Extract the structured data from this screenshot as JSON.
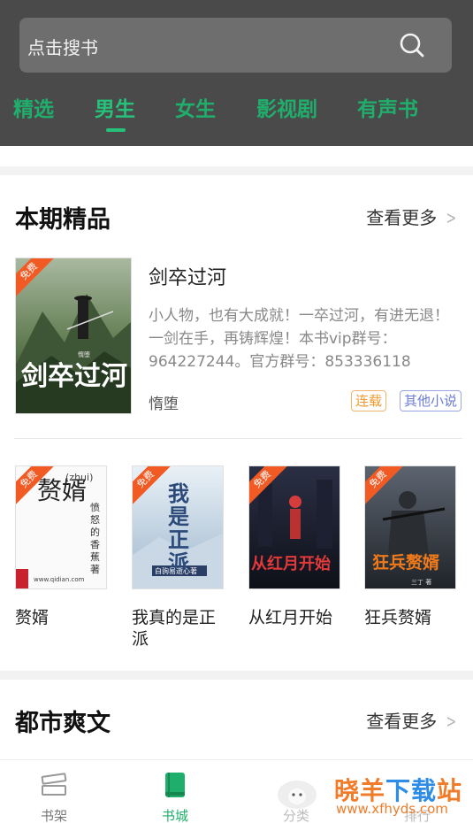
{
  "search": {
    "placeholder": "点击搜书"
  },
  "tabs": [
    {
      "label": "精选",
      "active": false
    },
    {
      "label": "男生",
      "active": true
    },
    {
      "label": "女生",
      "active": false
    },
    {
      "label": "影视剧",
      "active": false
    },
    {
      "label": "有声书",
      "active": false
    }
  ],
  "section1": {
    "title": "本期精品",
    "more": "查看更多",
    "featured": {
      "badge": "免费",
      "cover_title": "剑卒过河",
      "cover_author": "惰堕",
      "title": "剑卒过河",
      "description": "小人物，也有大成就！一卒过河，有进无退！一剑在手，再铸辉煌！本书vip群号：964227244。官方群号：853336118",
      "author": "惰堕",
      "tags": [
        "连载",
        "其他小说"
      ]
    },
    "books": [
      {
        "title": "赘婿",
        "badge": "免费",
        "cover_text": "赘婿",
        "cover_sub": "(zhui)",
        "cover_side": "愤怒的香蕉 著",
        "cover_url": "www.qidian.com"
      },
      {
        "title": "我真的是正派",
        "badge": "免费",
        "cover_text": "我是正派",
        "cover_author": "白驹易逝心著"
      },
      {
        "title": "从红月开始",
        "badge": "免费",
        "cover_text": "从红月开始"
      },
      {
        "title": "狂兵赘婿",
        "badge": "免费",
        "cover_text": "狂兵赘婿",
        "cover_author": "三丁 著"
      }
    ]
  },
  "section2": {
    "title": "都市爽文",
    "more": "查看更多"
  },
  "bottom_nav": [
    {
      "label": "书架",
      "icon": "bookshelf-icon",
      "active": false
    },
    {
      "label": "书城",
      "icon": "book-store-icon",
      "active": true
    },
    {
      "label": "分类",
      "icon": "category-icon",
      "active": false
    },
    {
      "label": "排行",
      "icon": "ranking-icon",
      "active": false
    }
  ],
  "watermark": {
    "orange": "晓羊",
    "blue": "下载",
    "orange2": "站",
    "url": "www.xfhyds.com"
  },
  "colors": {
    "accent": "#1fae6b",
    "header_bg": "#4a4a4a",
    "badge": "#f25a24"
  }
}
